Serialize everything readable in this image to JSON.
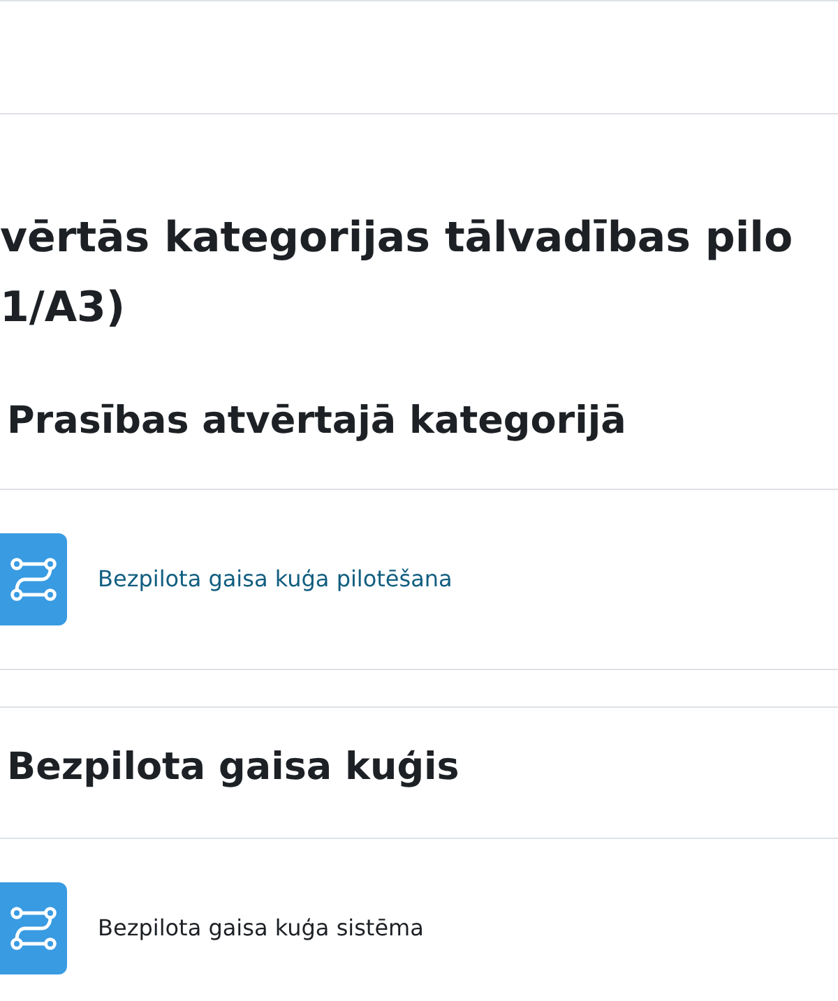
{
  "page_title": [
    "vērtās kategorijas tālvadības pilo",
    "1/A3)"
  ],
  "sections": [
    {
      "heading": "Prasības atvērtajā kategorijā",
      "activities": [
        {
          "kind": "link",
          "label": "Bezpilota gaisa kuģa pilotēšana"
        }
      ]
    },
    {
      "heading": "Bezpilota gaisa kuģis",
      "activities": [
        {
          "kind": "text",
          "label": "Bezpilota gaisa kuģa sistēma"
        }
      ]
    }
  ]
}
